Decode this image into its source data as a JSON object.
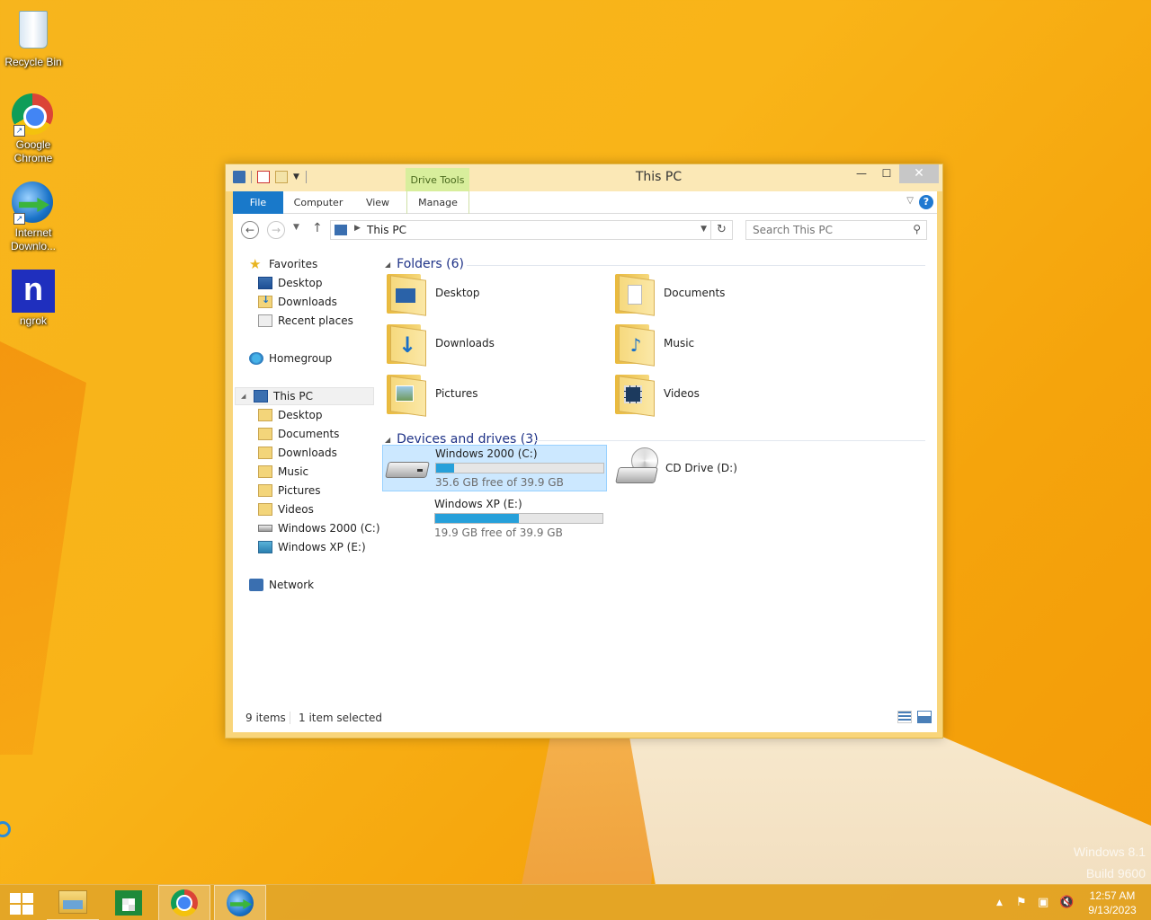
{
  "desktop": {
    "icons": [
      {
        "label": "Recycle Bin",
        "icon": "recycle-bin-icon"
      },
      {
        "label": "Google Chrome",
        "icon": "chrome-icon"
      },
      {
        "label": "Internet Downlo...",
        "icon": "idm-icon"
      },
      {
        "label": "ngrok",
        "icon": "ngrok-icon"
      }
    ],
    "watermark": {
      "line1": "Windows 8.1",
      "line2": "Build 9600"
    }
  },
  "window": {
    "title": "This PC",
    "contextual_tab_group": "Drive Tools",
    "ribbon_tabs": [
      "File",
      "Computer",
      "View",
      "Manage"
    ],
    "address": {
      "path": "This PC"
    },
    "search": {
      "placeholder": "Search This PC"
    },
    "nav_pane": {
      "favorites": {
        "label": "Favorites",
        "items": [
          "Desktop",
          "Downloads",
          "Recent places"
        ]
      },
      "homegroup": "Homegroup",
      "this_pc": {
        "label": "This PC",
        "items": [
          "Desktop",
          "Documents",
          "Downloads",
          "Music",
          "Pictures",
          "Videos",
          "Windows 2000 (C:)",
          "Windows XP (E:)"
        ]
      },
      "network": "Network"
    },
    "folders_header": "Folders (6)",
    "folders": [
      {
        "name": "Desktop",
        "icon": "desktop-folder-icon"
      },
      {
        "name": "Documents",
        "icon": "documents-folder-icon"
      },
      {
        "name": "Downloads",
        "icon": "downloads-folder-icon"
      },
      {
        "name": "Music",
        "icon": "music-folder-icon"
      },
      {
        "name": "Pictures",
        "icon": "pictures-folder-icon"
      },
      {
        "name": "Videos",
        "icon": "videos-folder-icon"
      }
    ],
    "drives_header": "Devices and drives (3)",
    "drives": [
      {
        "name": "Windows 2000 (C:)",
        "free_text": "35.6 GB free of 39.9 GB",
        "used_fraction": 0.108,
        "selected": true
      },
      {
        "name": "Windows XP (E:)",
        "free_text": "19.9 GB free of 39.9 GB",
        "used_fraction": 0.501,
        "selected": false
      },
      {
        "name": "CD Drive (D:)"
      }
    ],
    "status": {
      "items": "9 items",
      "selected": "1 item selected"
    }
  },
  "taskbar": {
    "buttons": [
      "start-button",
      "file-explorer",
      "windows-store",
      "google-chrome",
      "internet-download-manager"
    ],
    "clock": {
      "time": "12:57 AM",
      "date": "9/13/2023"
    }
  },
  "colors": {
    "accent": "#1979ca",
    "drive_bar": "#26a0da",
    "selection": "#cce8ff",
    "header_blue": "#1e3287"
  }
}
